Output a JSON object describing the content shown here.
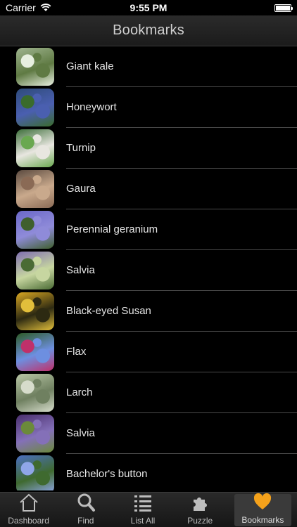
{
  "status": {
    "carrier": "Carrier",
    "time": "9:55 PM"
  },
  "nav": {
    "title": "Bookmarks"
  },
  "bookmarks": [
    {
      "label": "Giant kale",
      "thumb": [
        "#9fb48f",
        "#5f7a43",
        "#e7efe0"
      ]
    },
    {
      "label": "Honeywort",
      "thumb": [
        "#2e4b7a",
        "#4a5fb0",
        "#3a6b2c"
      ]
    },
    {
      "label": "Turnip",
      "thumb": [
        "#3d6f3a",
        "#e8e6e0",
        "#6aa850"
      ]
    },
    {
      "label": "Gaura",
      "thumb": [
        "#5b4a3f",
        "#c9a98c",
        "#8a6a55"
      ]
    },
    {
      "label": "Perennial geranium",
      "thumb": [
        "#6b68c8",
        "#8f8bd9",
        "#3f5f2d"
      ]
    },
    {
      "label": "Salvia",
      "thumb": [
        "#7f6fb0",
        "#c7d6a0",
        "#4a6b34"
      ]
    },
    {
      "label": "Black-eyed Susan",
      "thumb": [
        "#d9a722",
        "#2d2a12",
        "#e2bf3b"
      ]
    },
    {
      "label": "Flax",
      "thumb": [
        "#2d5a26",
        "#6d8fe0",
        "#c0306a"
      ]
    },
    {
      "label": "Larch",
      "thumb": [
        "#b9c7a6",
        "#6f8060",
        "#d6dccb"
      ]
    },
    {
      "label": "Salvia",
      "thumb": [
        "#4a2f6e",
        "#8470b8",
        "#6b8a3a"
      ]
    },
    {
      "label": "Bachelor's button",
      "thumb": [
        "#4b6fc2",
        "#3f6a2f",
        "#8fa6e8"
      ]
    }
  ],
  "tabs": [
    {
      "label": "Dashboard",
      "icon": "house-icon"
    },
    {
      "label": "Find",
      "icon": "magnifier-icon"
    },
    {
      "label": "List All",
      "icon": "list-icon"
    },
    {
      "label": "Puzzle",
      "icon": "puzzle-icon"
    },
    {
      "label": "Bookmarks",
      "icon": "heart-icon",
      "active": true,
      "accent": "#f5a21b"
    }
  ]
}
